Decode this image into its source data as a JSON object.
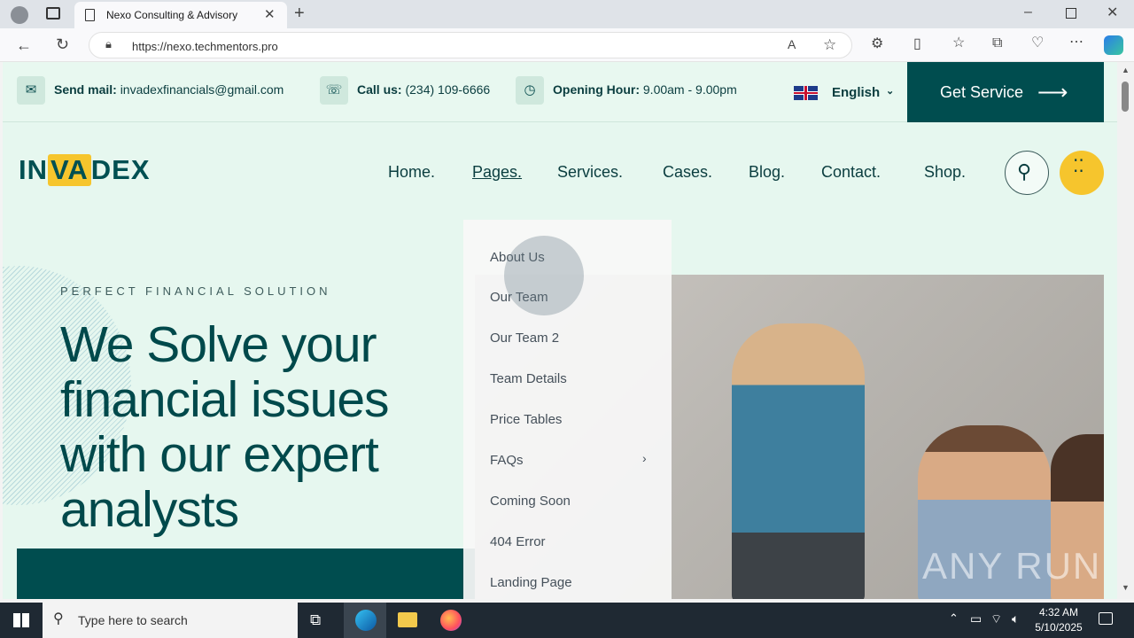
{
  "browser": {
    "tab_title": "Nexo Consulting & Advisory",
    "url": "https://nexo.techmentors.pro"
  },
  "topbar": {
    "mail_label": "Send mail:",
    "mail_value": "invadexfinancials@gmail.com",
    "call_label": "Call us:",
    "call_value": "(234) 109-6666",
    "hours_label": "Opening Hour:",
    "hours_value": "9.00am - 9.00pm",
    "language": "English",
    "cta": "Get Service"
  },
  "logo": {
    "left": "IN",
    "mid": "VA",
    "right": "DEX"
  },
  "nav": {
    "items": [
      "Home.",
      "Pages.",
      "Services.",
      "Cases.",
      "Blog.",
      "Contact.",
      "Shop."
    ]
  },
  "hero": {
    "eyebrow": "PERFECT FINANCIAL SOLUTION",
    "title": "We Solve your financial issues with our expert analysts"
  },
  "dropdown": {
    "items": [
      "About Us",
      "Our Team",
      "Our Team 2",
      "Team Details",
      "Price Tables",
      "FAQs",
      "Coming Soon",
      "404 Error",
      "Landing Page"
    ]
  },
  "watermark": "ANY RUN",
  "taskbar": {
    "search_placeholder": "Type here to search",
    "time": "4:32 AM",
    "date": "5/10/2025"
  },
  "colors": {
    "brand": "#004d4f",
    "accent": "#f6c52d",
    "page_bg": "#e6f7ef"
  }
}
